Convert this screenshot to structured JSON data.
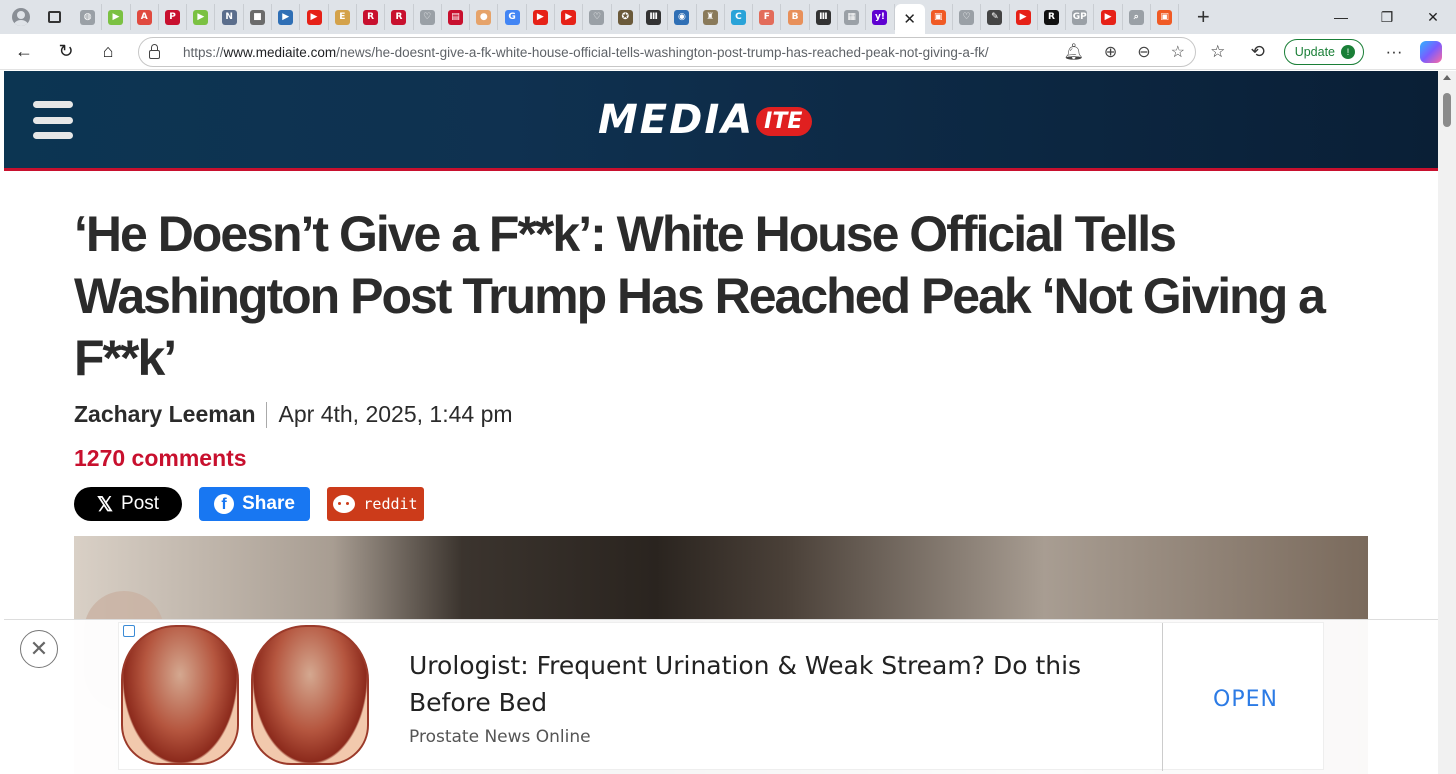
{
  "browser": {
    "tab_favicons": [
      {
        "icon": "globe-icon",
        "color": "#9aa0a6",
        "glyph": "◍"
      },
      {
        "icon": "play-icon",
        "color": "#7bc142",
        "glyph": "▶"
      },
      {
        "icon": "adobe-icon",
        "color": "#e04a3f",
        "glyph": "A"
      },
      {
        "icon": "pinterest-icon",
        "color": "#c8102e",
        "glyph": "P"
      },
      {
        "icon": "play-icon",
        "color": "#7bc142",
        "glyph": "▶"
      },
      {
        "icon": "news-icon",
        "color": "#5b6e8c",
        "glyph": "N"
      },
      {
        "icon": "folder-icon",
        "color": "#6b6b6b",
        "glyph": "■"
      },
      {
        "icon": "arrow-icon",
        "color": "#2f6fb5",
        "glyph": "▶"
      },
      {
        "icon": "youtube-icon",
        "color": "#e62117",
        "glyph": "▶"
      },
      {
        "icon": "e-icon",
        "color": "#d4a24a",
        "glyph": "E"
      },
      {
        "icon": "r-icon",
        "color": "#c8102e",
        "glyph": "R"
      },
      {
        "icon": "r-icon",
        "color": "#c8102e",
        "glyph": "R"
      },
      {
        "icon": "heart-icon",
        "color": "#9aa0a6",
        "glyph": "♡"
      },
      {
        "icon": "doc-icon",
        "color": "#c8102e",
        "glyph": "▤"
      },
      {
        "icon": "circle-icon",
        "color": "#e6a36a",
        "glyph": "●"
      },
      {
        "icon": "google-icon",
        "color": "#4285f4",
        "glyph": "G"
      },
      {
        "icon": "youtube-icon",
        "color": "#e62117",
        "glyph": "▶"
      },
      {
        "icon": "youtube-icon",
        "color": "#e62117",
        "glyph": "▶"
      },
      {
        "icon": "heart-icon",
        "color": "#9aa0a6",
        "glyph": "♡"
      },
      {
        "icon": "seal-icon",
        "color": "#6b5a3a",
        "glyph": "✪"
      },
      {
        "icon": "bars-icon",
        "color": "#333333",
        "glyph": "Ⅲ"
      },
      {
        "icon": "shield-icon",
        "color": "#2f6fb5",
        "glyph": "◉"
      },
      {
        "icon": "figure-icon",
        "color": "#8a7a5a",
        "glyph": "♜"
      },
      {
        "icon": "c-icon",
        "color": "#2aa3d8",
        "glyph": "C"
      },
      {
        "icon": "f-icon",
        "color": "#e36c5a",
        "glyph": "F"
      },
      {
        "icon": "b-icon",
        "color": "#e8905a",
        "glyph": "B"
      },
      {
        "icon": "bars-icon",
        "color": "#333333",
        "glyph": "Ⅲ"
      },
      {
        "icon": "image-icon",
        "color": "#9aa0a6",
        "glyph": "▦"
      },
      {
        "icon": "yahoo-icon",
        "color": "#5f01d1",
        "glyph": "y!"
      }
    ],
    "tab_favicons_after_active": [
      {
        "icon": "bookmark-icon",
        "color": "#f05a24",
        "glyph": "▣"
      },
      {
        "icon": "heart-icon",
        "color": "#9aa0a6",
        "glyph": "♡"
      },
      {
        "icon": "feather-icon",
        "color": "#444444",
        "glyph": "✎"
      },
      {
        "icon": "youtube-icon",
        "color": "#e62117",
        "glyph": "▶"
      },
      {
        "icon": "r-icon",
        "color": "#111111",
        "glyph": "R"
      },
      {
        "icon": "gp-icon",
        "color": "#9aa0a6",
        "glyph": "GP"
      },
      {
        "icon": "youtube-icon",
        "color": "#e62117",
        "glyph": "▶"
      },
      {
        "icon": "search-icon",
        "color": "#9aa0a6",
        "glyph": "⌕"
      },
      {
        "icon": "bookmark-icon",
        "color": "#f05a24",
        "glyph": "▣"
      }
    ],
    "url_prefix": "https://",
    "url_domain": "www.mediaite.com",
    "url_path": "/news/he-doesnt-give-a-fk-white-house-official-tells-washington-post-trump-has-reached-peak-not-giving-a-fk/",
    "update_label": "Update"
  },
  "site": {
    "logo_main": "MEDIA",
    "logo_badge": "ITE",
    "brand_red": "#c8102e"
  },
  "article": {
    "headline": "‘He Doesn’t Give a F**k’: White House Official Tells Washington Post Trump Has Reached Peak ‘Not Giving a F**k’",
    "author": "Zachary Leeman",
    "date": "Apr 4th, 2025, 1:44 pm",
    "comments": "1270 comments",
    "share_x": "Post",
    "share_facebook": "Share",
    "share_reddit": "reddit"
  },
  "ad": {
    "title": "Urologist: Frequent Urination & Weak Stream? Do this Before Bed",
    "source": "Prostate News Online",
    "cta": "OPEN",
    "cta_color": "#2c7be5"
  }
}
